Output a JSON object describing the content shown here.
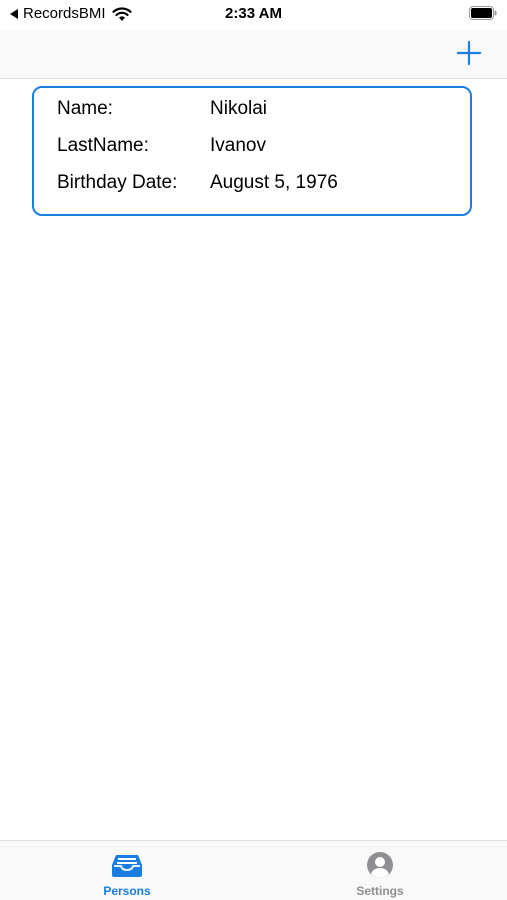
{
  "status_bar": {
    "back_app": "RecordsBMI",
    "time": "2:33 AM"
  },
  "nav_bar": {
    "add_icon": "plus-icon",
    "accent_color": "#1a7ee0"
  },
  "person_card": {
    "rows": [
      {
        "label": "Name:",
        "value": "Nikolai"
      },
      {
        "label": "LastName:",
        "value": "Ivanov"
      },
      {
        "label": "Birthday Date:",
        "value": "August 5, 1976"
      }
    ]
  },
  "tab_bar": {
    "tabs": [
      {
        "label": "Persons",
        "icon": "tray-icon",
        "selected": true,
        "color": "#1a7ee0"
      },
      {
        "label": "Settings",
        "icon": "person-circle-icon",
        "selected": false,
        "color": "#8e8e93"
      }
    ]
  }
}
